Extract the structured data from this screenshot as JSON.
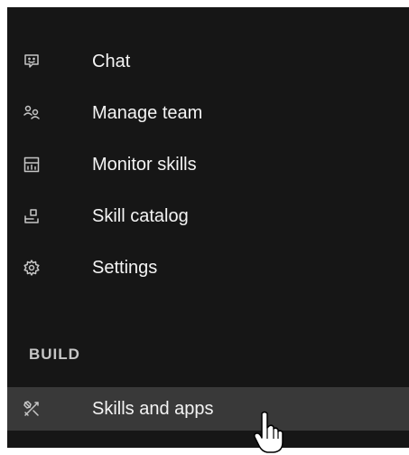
{
  "nav": {
    "items": [
      {
        "label": "Chat",
        "icon": "chat-icon"
      },
      {
        "label": "Manage team",
        "icon": "users-icon"
      },
      {
        "label": "Monitor skills",
        "icon": "dashboard-icon"
      },
      {
        "label": "Skill catalog",
        "icon": "catalog-icon"
      },
      {
        "label": "Settings",
        "icon": "gear-icon"
      }
    ],
    "section_build": "BUILD",
    "build_items": [
      {
        "label": "Skills and apps",
        "icon": "tools-icon",
        "active": true
      }
    ]
  },
  "colors": {
    "background": "#161616",
    "active_background": "#393939",
    "text": "#f4f4f4",
    "icon": "#c6c6c6"
  }
}
